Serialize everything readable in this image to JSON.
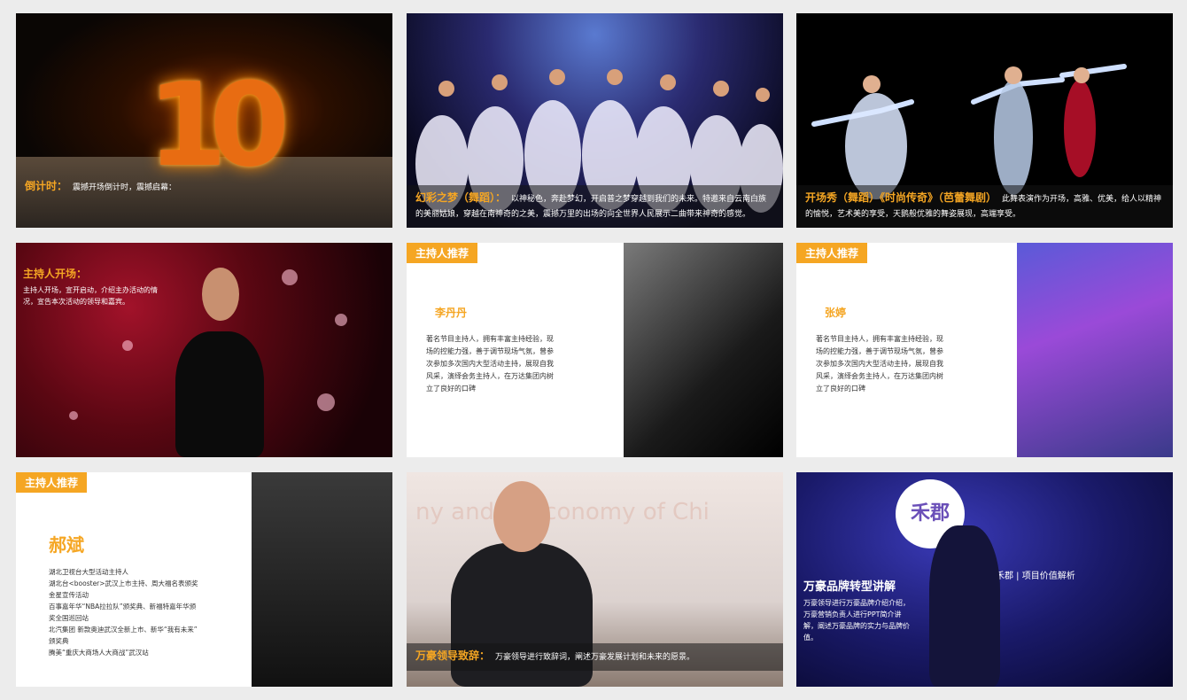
{
  "tiles": {
    "countdown": {
      "title": "倒计时：",
      "text": "震撼开场倒计时，震撼启幕："
    },
    "dance1": {
      "title": "幻彩之梦（舞蹈）：",
      "text": "以神秘色，奔赴梦幻，开启普之梦穿越到我们的未来。特邀来自云南白族的美丽姑娘，穿越在南神奇的之美，震撼万里的出场的向全世界人民展示二曲带来神奇的感觉。"
    },
    "dance2": {
      "title": "开场秀（舞蹈）《时尚传奇》（芭蕾舞剧）",
      "text": "此舞表演作为开场，高雅、优美，给人以精神的愉悦，艺术美的享受，天鹅般优雅的舞姿展现，高端享受。"
    },
    "host_open": {
      "title": "主持人开场：",
      "text": "主持人开场，宣开启动，介绍主办活动的情况，宣告本次活动的领导和嘉宾。"
    },
    "host1": {
      "tag": "主持人推荐",
      "name": "李丹丹",
      "desc": "著名节目主持人，拥有丰富主持经验，现场的控能力强，善于调节现场气氛，曾参次参加多次国内大型活动主持，展现自我风采，演绎会务主持人，在万达集团内树立了良好的口碑"
    },
    "host2": {
      "tag": "主持人推荐",
      "name": "张婷",
      "desc": "著名节目主持人，拥有丰富主持经验，现场的控能力强，善于调节现场气氛，曾参次参加多次国内大型活动主持，展现自我风采，演绎会务主持人，在万达集团内树立了良好的口碑"
    },
    "host3": {
      "tag": "主持人推荐",
      "name": "郝斌",
      "lines": [
        "湖北卫视台大型活动主持人",
        "湖北台<booster>武汉上市主持、周大福名表颁奖",
        "金星宣传活动",
        "百事嘉年华“NBA拉拉队”颁奖典、新福特嘉年华颁",
        "奖全国巡回站",
        "北汽集团 新款奥迪武汉全新上市、新华“我有未来”",
        "颁奖典",
        "腾美“重庆大商场人大商战”武汉站"
      ]
    },
    "speech": {
      "title": "万豪领导致辞：",
      "text": "万豪领导进行致辞词，阐述万豪发展计划和未来的愿景。",
      "bg_text": "ny and  al Economy of Chi"
    },
    "brand": {
      "title": "万豪品牌转型讲解",
      "text": "万豪领导进行万豪品牌介绍介绍，万豪营销负责人进行PPT简介讲解，阐述万豪品牌的实力与品牌价值。",
      "logo": "禾郡",
      "screen_text": "禾郡 | 项目价值解析"
    }
  },
  "colors": {
    "accent": "#f5a623",
    "background": "#ececec"
  }
}
